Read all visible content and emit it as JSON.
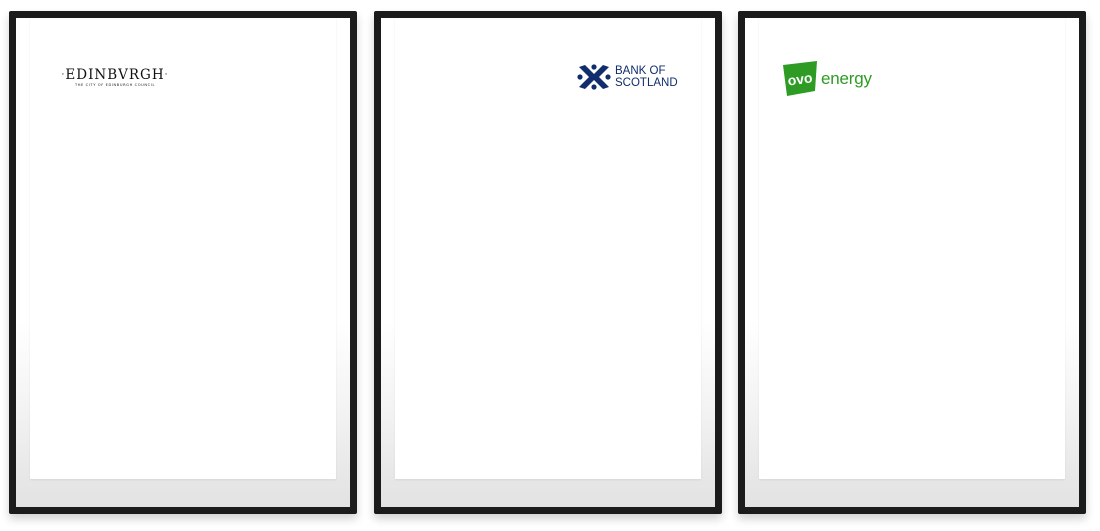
{
  "frames": [
    {
      "logo": {
        "name": "City of Edinburgh Council",
        "wordmark_left_dot": "·",
        "wordmark": "EDINBVRGH",
        "wordmark_right_dot": "·",
        "subtitle": "THE CITY OF EDINBURGH COUNCIL",
        "color": "#111111"
      }
    },
    {
      "logo": {
        "name": "Bank of Scotland",
        "line1": "BANK OF",
        "line2": "SCOTLAND",
        "icon": "saltire-cross-icon",
        "color": "#112d6e"
      }
    },
    {
      "logo": {
        "name": "OVO Energy",
        "mark": "ovo",
        "word": "energy",
        "icon": "ovo-badge-icon",
        "color": "#2e9c24"
      }
    }
  ],
  "colors": {
    "frame": "#1b1b1b",
    "paper": "#ffffff",
    "mat_shadow": "#e2e2e2"
  }
}
